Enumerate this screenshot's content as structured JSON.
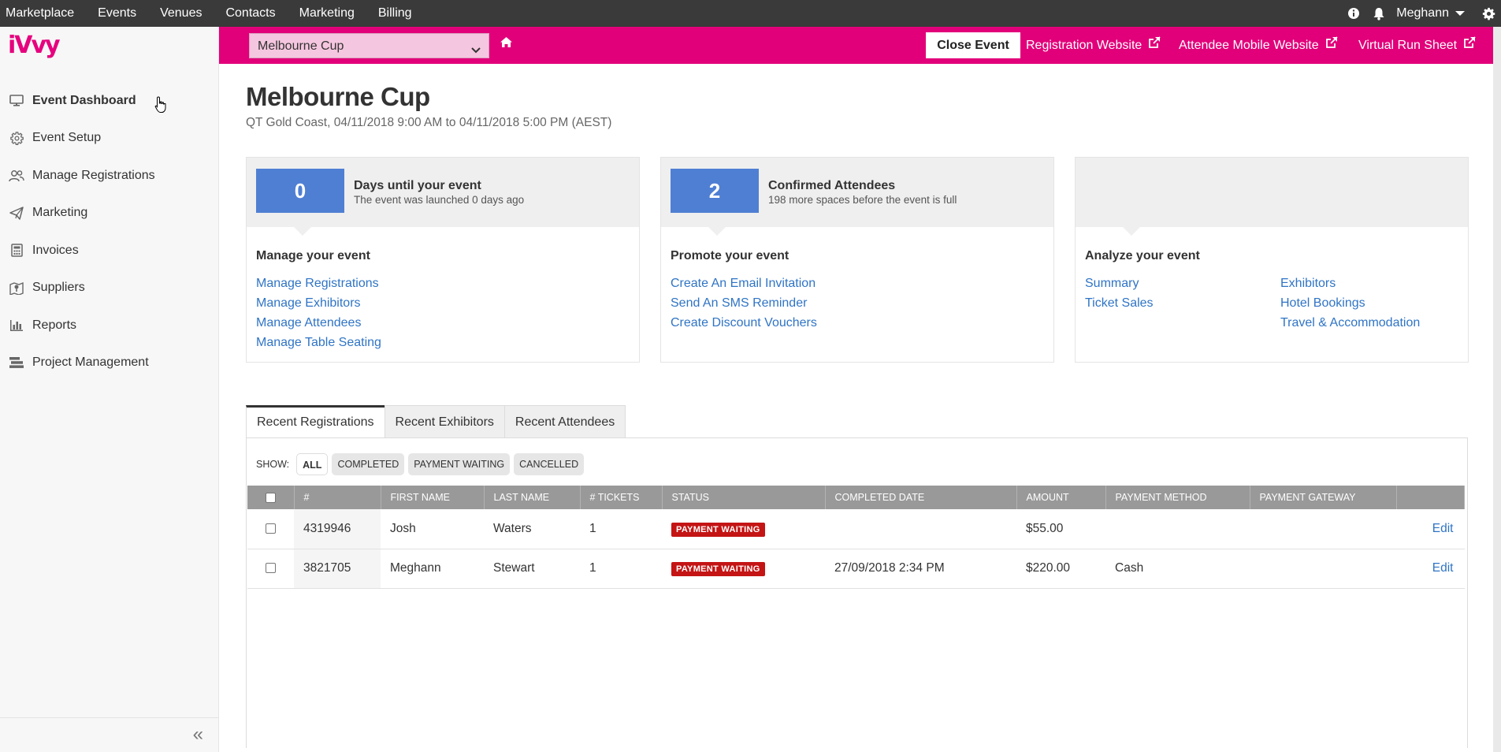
{
  "topnav": {
    "items": [
      "Marketplace",
      "Events",
      "Venues",
      "Contacts",
      "Marketing",
      "Billing"
    ],
    "user": "Meghann",
    "icons": [
      "info-icon",
      "bell-icon",
      "gear-icon"
    ]
  },
  "brand": {
    "logo": "iVvy",
    "color": "#e6007e"
  },
  "sidebar": {
    "items": [
      {
        "label": "Event Dashboard",
        "icon": "monitor-icon"
      },
      {
        "label": "Event Setup",
        "icon": "gear-icon"
      },
      {
        "label": "Manage Registrations",
        "icon": "users-icon"
      },
      {
        "label": "Marketing",
        "icon": "paper-plane-icon"
      },
      {
        "label": "Invoices",
        "icon": "calculator-icon"
      },
      {
        "label": "Suppliers",
        "icon": "map-icon"
      },
      {
        "label": "Reports",
        "icon": "bar-chart-icon"
      },
      {
        "label": "Project Management",
        "icon": "tasks-icon"
      }
    ],
    "active_index": 0
  },
  "eventbar": {
    "selected_event": "Melbourne Cup",
    "close_label": "Close Event",
    "links": [
      "Registration Website",
      "Attendee Mobile Website",
      "Virtual Run Sheet"
    ],
    "accent": "#e2007a"
  },
  "event": {
    "title": "Melbourne Cup",
    "subtitle": "QT Gold Coast, 04/11/2018 9:00 AM to 04/11/2018 5:00 PM (AEST)"
  },
  "cards": [
    {
      "number": "0",
      "stat_title": "Days until your event",
      "stat_sub": "The event was launched 0 days ago",
      "section": "Manage your event",
      "links": [
        "Manage Registrations",
        "Manage Exhibitors",
        "Manage Attendees",
        "Manage Table Seating"
      ]
    },
    {
      "number": "2",
      "stat_title": "Confirmed Attendees",
      "stat_sub": "198 more spaces before the event is full",
      "section": "Promote your event",
      "links": [
        "Create An Email Invitation",
        "Send An SMS Reminder",
        "Create Discount Vouchers"
      ]
    },
    {
      "section": "Analyze your event",
      "links_col1": [
        "Summary",
        "Ticket Sales"
      ],
      "links_col2": [
        "Exhibitors",
        "Hotel Bookings",
        "Travel & Accommodation"
      ]
    }
  ],
  "tabs": [
    "Recent Registrations",
    "Recent Exhibitors",
    "Recent Attendees"
  ],
  "filters": {
    "label": "SHOW:",
    "options": [
      "ALL",
      "COMPLETED",
      "PAYMENT WAITING",
      "CANCELLED"
    ]
  },
  "table": {
    "headers": [
      "#",
      "FIRST NAME",
      "LAST NAME",
      "# TICKETS",
      "STATUS",
      "COMPLETED DATE",
      "AMOUNT",
      "PAYMENT METHOD",
      "PAYMENT GATEWAY"
    ],
    "rows": [
      {
        "id": "4319946",
        "first": "Josh",
        "last": "Waters",
        "tickets": "1",
        "status": "PAYMENT WAITING",
        "date": "",
        "amount": "$55.00",
        "method": "",
        "gateway": "",
        "action": "Edit"
      },
      {
        "id": "3821705",
        "first": "Meghann",
        "last": "Stewart",
        "tickets": "1",
        "status": "PAYMENT WAITING",
        "date": "27/09/2018 2:34 PM",
        "amount": "$220.00",
        "method": "Cash",
        "gateway": "",
        "action": "Edit"
      }
    ]
  }
}
